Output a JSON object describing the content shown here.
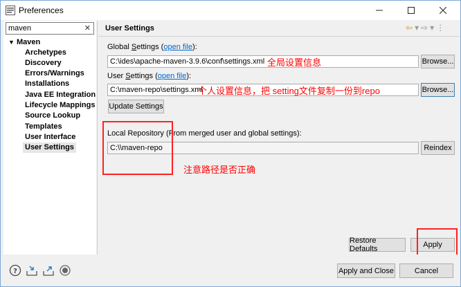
{
  "window": {
    "title": "Preferences",
    "minimize_icon": "minimize-icon",
    "maximize_icon": "maximize-icon",
    "close_icon": "close-icon"
  },
  "sidebar": {
    "filter_value": "maven",
    "filter_clear": "✕",
    "root": "Maven",
    "items": [
      {
        "label": "Archetypes"
      },
      {
        "label": "Discovery"
      },
      {
        "label": "Errors/Warnings"
      },
      {
        "label": "Installations"
      },
      {
        "label": "Java EE Integration"
      },
      {
        "label": "Lifecycle Mappings"
      },
      {
        "label": "Source Lookup"
      },
      {
        "label": "Templates"
      },
      {
        "label": "User Interface"
      },
      {
        "label": "User Settings"
      }
    ],
    "selected": "User Settings"
  },
  "main": {
    "title": "User Settings",
    "global": {
      "label_prefix": "Global ",
      "label_mnemonic": "S",
      "label_rest": "ettings (",
      "link": "open file",
      "label_suffix": "):",
      "value": "C:\\ides\\apache-maven-3.9.6\\conf\\settings.xml",
      "browse": "Browse..."
    },
    "user": {
      "label_prefix": "User ",
      "label_mnemonic": "S",
      "label_rest": "ettings (",
      "link": "open file",
      "label_suffix": "):",
      "value": "C:\\maven-repo\\settings.xml",
      "browse": "Browse..."
    },
    "update_button": "Update Settings",
    "local_repo": {
      "label": "Local Repository (From merged user and global settings):",
      "value": "C:\\\\maven-repo",
      "reindex": "Reindex"
    },
    "restore_defaults": "Restore Defaults",
    "apply": "Apply"
  },
  "annotations": {
    "global": "全局设置信息",
    "user": "个人设置信息，把 setting文件复制一份到repo",
    "path": "注意路径是否正确"
  },
  "footer": {
    "apply_and_close": "Apply and Close",
    "cancel": "Cancel"
  },
  "colors": {
    "annotation": "#ff0000",
    "link": "#0066cc",
    "focus_border": "#3c7fb1"
  }
}
